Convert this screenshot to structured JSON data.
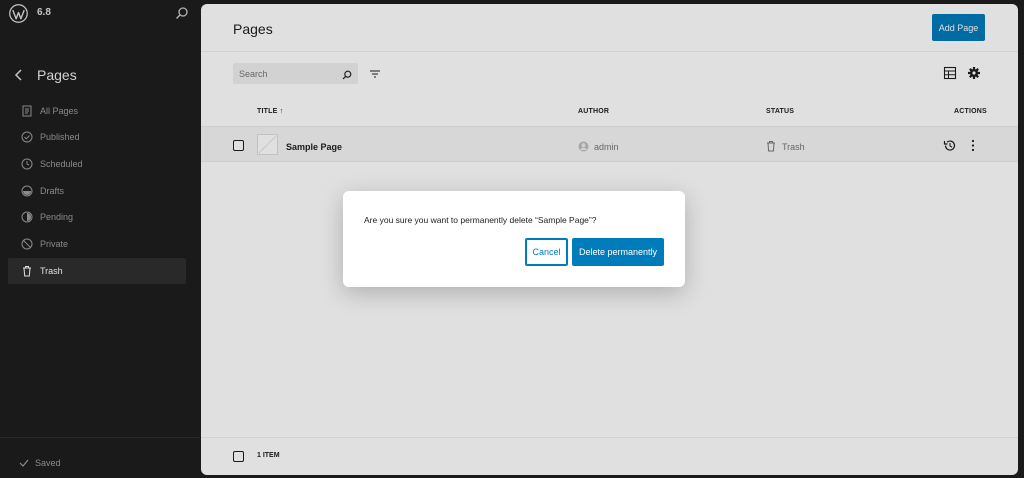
{
  "sidebar": {
    "version": "6.8",
    "title": "Pages",
    "items": [
      {
        "label": "All Pages",
        "icon": "pages-icon"
      },
      {
        "label": "Published",
        "icon": "published-icon"
      },
      {
        "label": "Scheduled",
        "icon": "scheduled-icon"
      },
      {
        "label": "Drafts",
        "icon": "drafts-icon"
      },
      {
        "label": "Pending",
        "icon": "pending-icon"
      },
      {
        "label": "Private",
        "icon": "private-icon"
      },
      {
        "label": "Trash",
        "icon": "trash-icon",
        "active": true
      }
    ],
    "status": "Saved"
  },
  "header": {
    "title": "Pages",
    "add_button": "Add Page"
  },
  "search": {
    "placeholder": "Search"
  },
  "table": {
    "columns": {
      "title": "TITLE ↑",
      "author": "AUTHOR",
      "status": "STATUS",
      "actions": "ACTIONS"
    },
    "rows": [
      {
        "title": "Sample Page",
        "author": "admin",
        "status": "Trash"
      }
    ],
    "count": "1 ITEM"
  },
  "dialog": {
    "message": "Are you sure you want to permanently delete “Sample Page”?",
    "cancel": "Cancel",
    "confirm": "Delete permanently"
  },
  "colors": {
    "accent": "#007cba",
    "sidebar_bg": "#1e1e1e"
  }
}
